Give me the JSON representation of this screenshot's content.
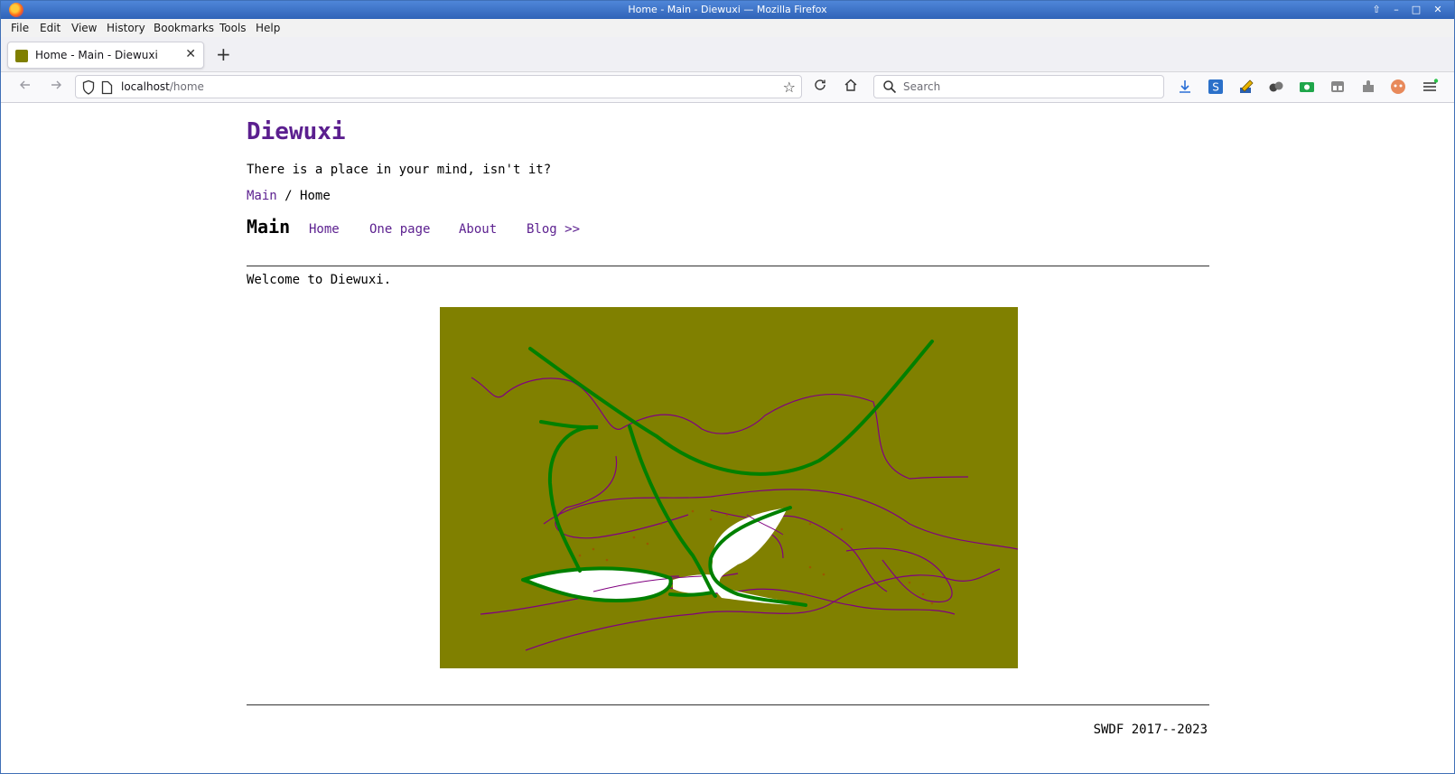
{
  "window": {
    "title": "Home - Main - Diewuxi — Mozilla Firefox"
  },
  "menu": {
    "items": [
      "File",
      "Edit",
      "View",
      "History",
      "Bookmarks",
      "Tools",
      "Help"
    ]
  },
  "tab": {
    "label": "Home - Main - Diewuxi"
  },
  "navbar": {
    "url_host": "localhost",
    "url_path": "/home",
    "search_placeholder": "Search"
  },
  "site": {
    "title": "Diewuxi",
    "tagline": "There is a place in your mind, isn't it?"
  },
  "breadcrumb": {
    "root": "Main",
    "separator": "/",
    "current": "Home"
  },
  "section": {
    "title": "Main",
    "links": [
      "Home",
      "One page",
      "About",
      "Blog >>"
    ]
  },
  "main": {
    "welcome": "Welcome to Diewuxi.",
    "artwork_background": "#808000",
    "artwork_stroke_green": "#008000",
    "artwork_stroke_purple": "#800080"
  },
  "footer": {
    "text": "SWDF 2017--2023"
  },
  "colors": {
    "link": "#5b1f8f",
    "titlebar": "#3f72c4"
  }
}
